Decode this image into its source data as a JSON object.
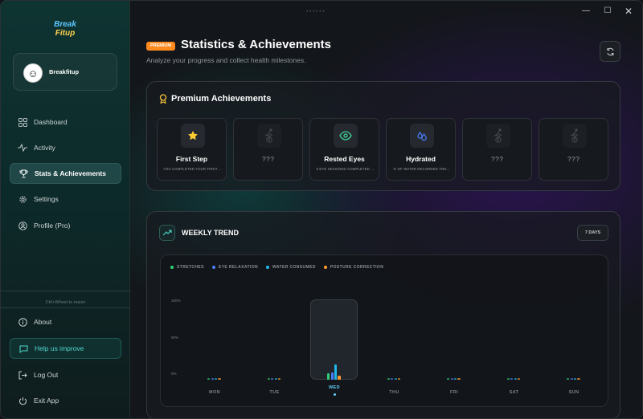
{
  "app": {
    "logo_line1": "Break",
    "logo_line2": "Fitup"
  },
  "profile": {
    "name": "Breakfitup"
  },
  "nav": [
    {
      "label": "Dashboard",
      "icon": "grid-icon"
    },
    {
      "label": "Activity",
      "icon": "pulse-icon"
    },
    {
      "label": "Stats & Achievements",
      "icon": "trophy-icon",
      "active": true
    },
    {
      "label": "Settings",
      "icon": "gear-icon"
    },
    {
      "label": "Profile (Pro)",
      "icon": "user-circle-icon"
    }
  ],
  "footer_nav": {
    "hint": "Ctrl+Wheel to resize",
    "about": "About",
    "improve": "Help us improve",
    "logout": "Log Out",
    "exit": "Exit App"
  },
  "header": {
    "badge": "PREMIUM",
    "title": "Statistics & Achievements",
    "subtitle": "Analyze your progress and collect health milestones."
  },
  "achievements": {
    "title": "Premium Achievements",
    "items": [
      {
        "name": "First Step",
        "desc": "YOU COMPLETED YOUR FIRST ...",
        "icon": "star-icon",
        "locked": false,
        "color": "#ffcc33"
      },
      {
        "name": "???",
        "desc": "",
        "icon": "locked-figure-icon",
        "locked": true
      },
      {
        "name": "Rested Eyes",
        "desc": "5 EYE SESSIONS COMPLETED ...",
        "icon": "eye-icon",
        "locked": false,
        "color": "#3ed39a"
      },
      {
        "name": "Hydrated",
        "desc": "% OF WATER RECORDED TOD...",
        "icon": "water-drops-icon",
        "locked": false,
        "color": "#4a7dff"
      },
      {
        "name": "???",
        "desc": "",
        "icon": "locked-figure-icon",
        "locked": true
      },
      {
        "name": "???",
        "desc": "",
        "icon": "locked-figure-icon",
        "locked": true
      }
    ]
  },
  "trend": {
    "title": "WEEKLY TREND",
    "range": "7 DAYS",
    "yticks": [
      "100%",
      "50%",
      "0%"
    ]
  },
  "chart_data": {
    "type": "bar",
    "categories": [
      "MON",
      "TUE",
      "WED",
      "THU",
      "FRI",
      "SAT",
      "SUN"
    ],
    "ylim": [
      0,
      100
    ],
    "grid": false,
    "legend": "top-left",
    "highlight": "WED",
    "series": [
      {
        "name": "STRETCHES",
        "color": "#2ecf7a",
        "values": [
          0,
          0,
          8,
          0,
          0,
          0,
          0
        ]
      },
      {
        "name": "EYE RELAXATION",
        "color": "#4a7dff",
        "values": [
          0,
          0,
          10,
          0,
          0,
          0,
          0
        ]
      },
      {
        "name": "WATER CONSUMED",
        "color": "#1fb8e8",
        "values": [
          0,
          0,
          20,
          0,
          0,
          0,
          0
        ]
      },
      {
        "name": "POSTURE CORRECTION",
        "color": "#ff9a2e",
        "values": [
          0,
          0,
          5,
          0,
          0,
          0,
          0
        ]
      }
    ]
  }
}
